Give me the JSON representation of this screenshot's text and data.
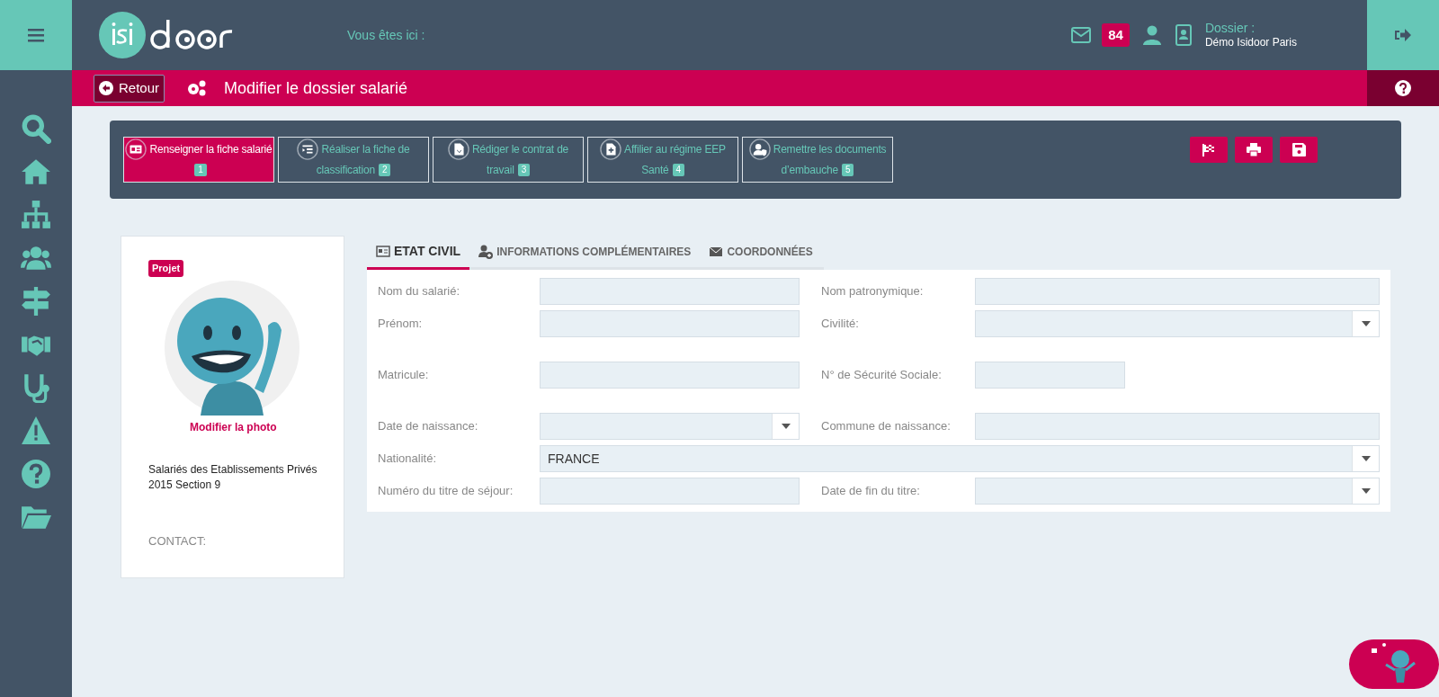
{
  "header": {
    "breadcrumb_label": "Vous êtes ici :",
    "mail_count": "84",
    "dossier_label": "Dossier :",
    "dossier_name": "Démo Isidoor Paris"
  },
  "title_bar": {
    "back_label": "Retour",
    "title": "Modifier le dossier salarié"
  },
  "steps": [
    {
      "label": "Renseigner la fiche salarié",
      "number": "1",
      "selected": true
    },
    {
      "label": "Réaliser la fiche de classification",
      "number": "2",
      "selected": false
    },
    {
      "label": "Rédiger le contrat de travail",
      "number": "3",
      "selected": false
    },
    {
      "label": "Affilier au régime EEP Santé",
      "number": "4",
      "selected": false
    },
    {
      "label": "Remettre les documents d’embauche",
      "number": "5",
      "selected": false
    }
  ],
  "profile": {
    "status": "Projet",
    "photo_link": "Modifier la photo",
    "convention": "Salariés des Etablissements Privés 2015 Section 9",
    "contact": "CONTACT:"
  },
  "tabs": [
    {
      "label": "ETAT CIVIL",
      "selected": true
    },
    {
      "label": "INFORMATIONS COMPLÉMENTAIRES",
      "selected": false
    },
    {
      "label": "COORDONNÉES",
      "selected": false
    }
  ],
  "form_rows": [
    [
      {
        "label": "Nom du salarié:",
        "kind": "text"
      },
      {
        "label": "Nom patronymique:",
        "kind": "text"
      }
    ],
    [
      {
        "label": "Prénom:",
        "kind": "text"
      },
      {
        "label": "Civilité:",
        "kind": "select"
      }
    ],
    [
      {
        "label": "Matricule:",
        "kind": "text"
      },
      {
        "label": "N° de Sécurité Sociale:",
        "kind": "short"
      }
    ],
    [
      {
        "label": "Date de naissance:",
        "kind": "select"
      },
      {
        "label": "Commune de naissance:",
        "kind": "text"
      }
    ],
    [
      {
        "label": "Nationalité:",
        "kind": "select",
        "value": "FRANCE"
      }
    ],
    [
      {
        "label": "Numéro du titre de séjour:",
        "kind": "text"
      },
      {
        "label": "Date de fin du titre:",
        "kind": "select"
      }
    ]
  ]
}
